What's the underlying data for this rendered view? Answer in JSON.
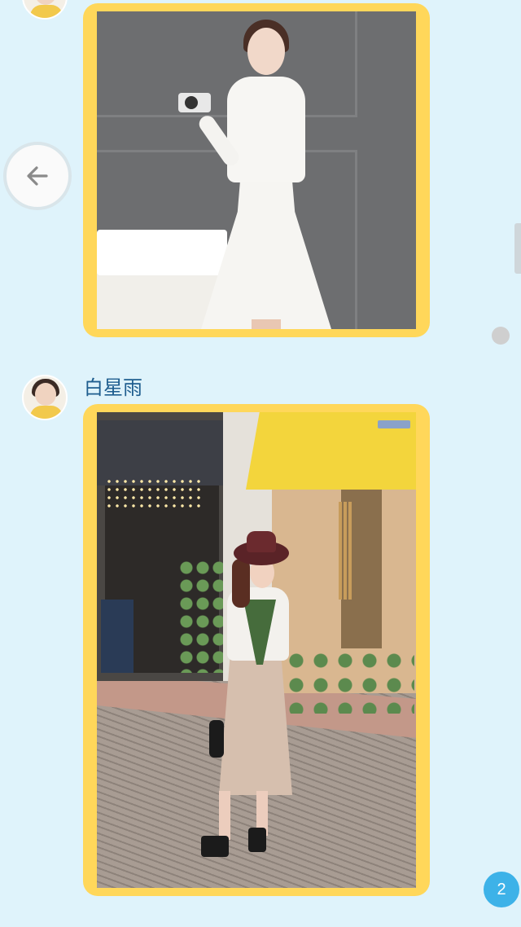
{
  "colors": {
    "background": "#dff3fb",
    "bubble_border": "#ffd75a",
    "name_text": "#1f5e8f",
    "badge": "#3db2e8"
  },
  "messages": [
    {
      "sender": "",
      "avatar_icon": "avatar-icon",
      "content_type": "image"
    },
    {
      "sender": "白星雨",
      "avatar_icon": "avatar-icon",
      "content_type": "image"
    }
  ],
  "controls": {
    "back_icon": "arrow-left-icon",
    "unread_count": "2"
  }
}
